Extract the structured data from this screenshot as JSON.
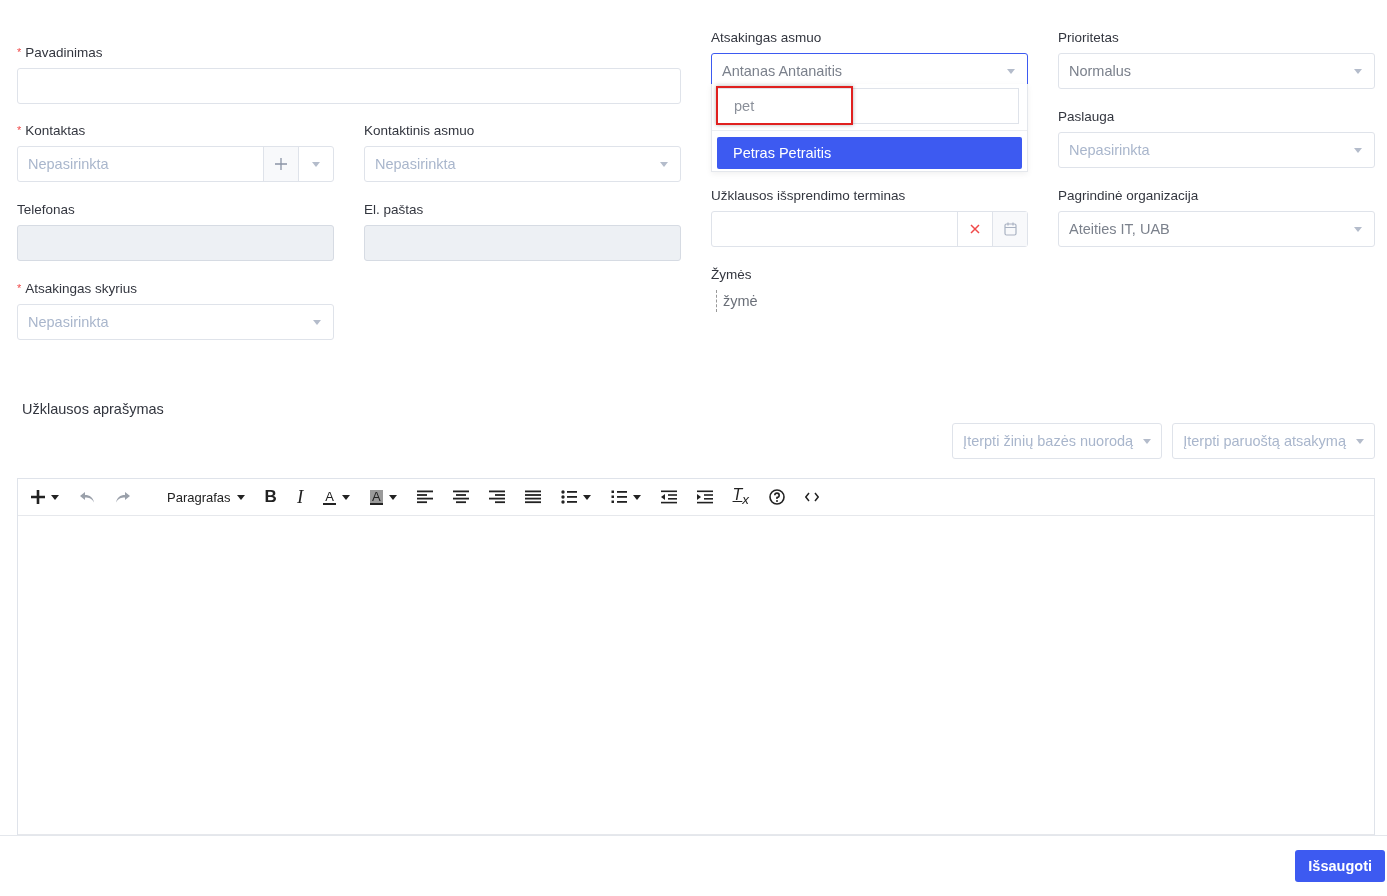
{
  "left_fields": [
    {
      "required_mark": "*",
      "label": "Pavadinimas",
      "kind": "wide_text"
    },
    {
      "required_mark": "*",
      "label": "Kontaktas",
      "kind": "select_add",
      "placeholder": "Nepasirinkta"
    },
    {
      "label": "Kontaktinis asmuo",
      "kind": "select",
      "placeholder": "Nepasirinkta"
    },
    {
      "label": "Telefonas",
      "kind": "readonly"
    },
    {
      "label": "El. paštas",
      "kind": "readonly"
    },
    {
      "required_mark": "*",
      "label": "Atsakingas skyrius",
      "kind": "select",
      "placeholder": "Nepasirinkta"
    }
  ],
  "right_columns": [
    [
      {
        "label": "Atsakingas asmuo",
        "kind": "select",
        "value": "Antanas Antanaitis",
        "open": true,
        "search": "pet",
        "options": [
          {
            "label": "Petras Petraitis",
            "selected": true
          }
        ]
      },
      {
        "label": "Užklausos išsprendimo terminas",
        "kind": "date"
      },
      {
        "label": "Žymės",
        "kind": "tags",
        "placeholder": "žymė"
      }
    ],
    [
      {
        "label": "Prioritetas",
        "kind": "select",
        "value": "Normalus"
      },
      {
        "label": "Paslauga",
        "kind": "select",
        "placeholder": "Nepasirinkta"
      },
      {
        "label": "Pagrindinė organizacija",
        "kind": "select",
        "value": "Ateities IT, UAB"
      }
    ]
  ],
  "description": {
    "label": "Užklausos aprašymas",
    "insert_buttons": [
      "Įterpti žinių bazės nuorodą",
      "Įterpti paruoštą atsakymą"
    ],
    "toolbar": [
      {
        "kind": "plus",
        "caret": true
      },
      {
        "kind": "undo",
        "disabled": true
      },
      {
        "kind": "redo",
        "disabled": true
      },
      {
        "kind": "text",
        "label": "Paragrafas",
        "caret": true
      },
      {
        "kind": "bold",
        "label": "B"
      },
      {
        "kind": "italic",
        "label": "I"
      },
      {
        "kind": "color",
        "label": "A",
        "caret": true
      },
      {
        "kind": "highlight",
        "label": "A",
        "caret": true
      },
      {
        "kind": "align-left"
      },
      {
        "kind": "align-center"
      },
      {
        "kind": "align-right"
      },
      {
        "kind": "justify"
      },
      {
        "kind": "bullets",
        "caret": true
      },
      {
        "kind": "numbers",
        "caret": true
      },
      {
        "kind": "outdent"
      },
      {
        "kind": "indent"
      },
      {
        "kind": "clear",
        "label": "T$_{x}$"
      },
      {
        "kind": "help"
      },
      {
        "kind": "code"
      }
    ]
  },
  "save_button": "Išsaugoti"
}
